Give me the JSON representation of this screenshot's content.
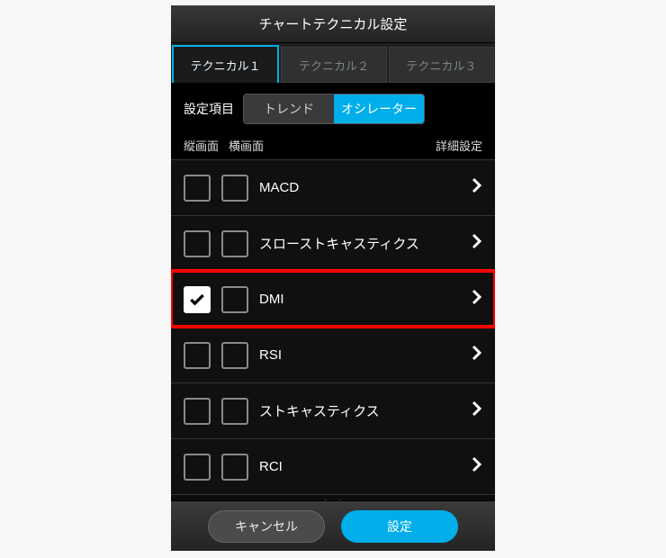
{
  "title": "チャートテクニカル設定",
  "tabs": [
    {
      "label": "テクニカル１",
      "active": true
    },
    {
      "label": "テクニカル２",
      "active": false
    },
    {
      "label": "テクニカル３",
      "active": false
    }
  ],
  "settings_label": "設定項目",
  "segments": [
    {
      "label": "トレンド",
      "active": false
    },
    {
      "label": "オシレーター",
      "active": true
    }
  ],
  "columns": {
    "portrait": "縦画面",
    "landscape": "横画面",
    "detail": "詳細設定"
  },
  "indicators": [
    {
      "label": "MACD",
      "portrait": false,
      "landscape": false,
      "highlight": false
    },
    {
      "label": "スローストキャスティクス",
      "portrait": false,
      "landscape": false,
      "highlight": false
    },
    {
      "label": "DMI",
      "portrait": true,
      "landscape": false,
      "highlight": true
    },
    {
      "label": "RSI",
      "portrait": false,
      "landscape": false,
      "highlight": false
    },
    {
      "label": "ストキャスティクス",
      "portrait": false,
      "landscape": false,
      "highlight": false
    },
    {
      "label": "RCI",
      "portrait": false,
      "landscape": false,
      "highlight": false
    }
  ],
  "buttons": {
    "cancel": "キャンセル",
    "ok": "設定"
  }
}
